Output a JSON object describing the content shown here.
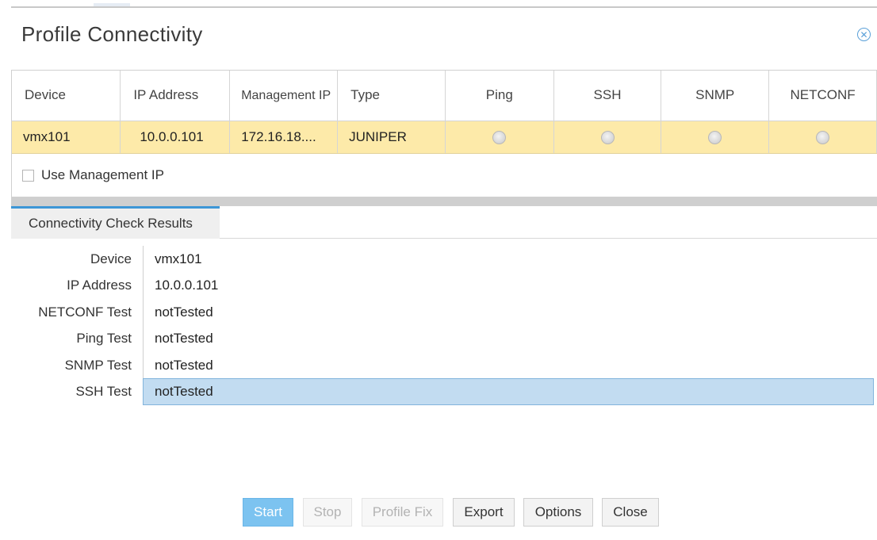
{
  "dialog": {
    "title": "Profile Connectivity",
    "close_icon": "close-circle-icon"
  },
  "grid": {
    "columns": [
      "Device",
      "IP Address",
      "Management IP",
      "Type",
      "Ping",
      "SSH",
      "SNMP",
      "NETCONF"
    ],
    "rows": [
      {
        "device": "vmx101",
        "ip_address": "10.0.0.101",
        "management_ip": "172.16.18....",
        "type": "JUNIPER",
        "ping": "radio-icon",
        "ssh": "radio-icon",
        "snmp": "radio-icon",
        "netconf": "radio-icon"
      }
    ],
    "selected_row_color": "#fdeaa9"
  },
  "use_management_ip": {
    "label": "Use Management IP",
    "checked": false
  },
  "results_tab": {
    "label": "Connectivity Check Results",
    "accent": "#3d96d6"
  },
  "results": [
    {
      "label": "Device",
      "value": "vmx101"
    },
    {
      "label": "IP Address",
      "value": "10.0.0.101"
    },
    {
      "label": "NETCONF Test",
      "value": "notTested"
    },
    {
      "label": "Ping Test",
      "value": "notTested"
    },
    {
      "label": "SNMP Test",
      "value": "notTested"
    },
    {
      "label": "SSH Test",
      "value": "notTested"
    }
  ],
  "buttons": {
    "start": "Start",
    "stop": "Stop",
    "profile_fix": "Profile Fix",
    "export": "Export",
    "options": "Options",
    "close": "Close"
  }
}
